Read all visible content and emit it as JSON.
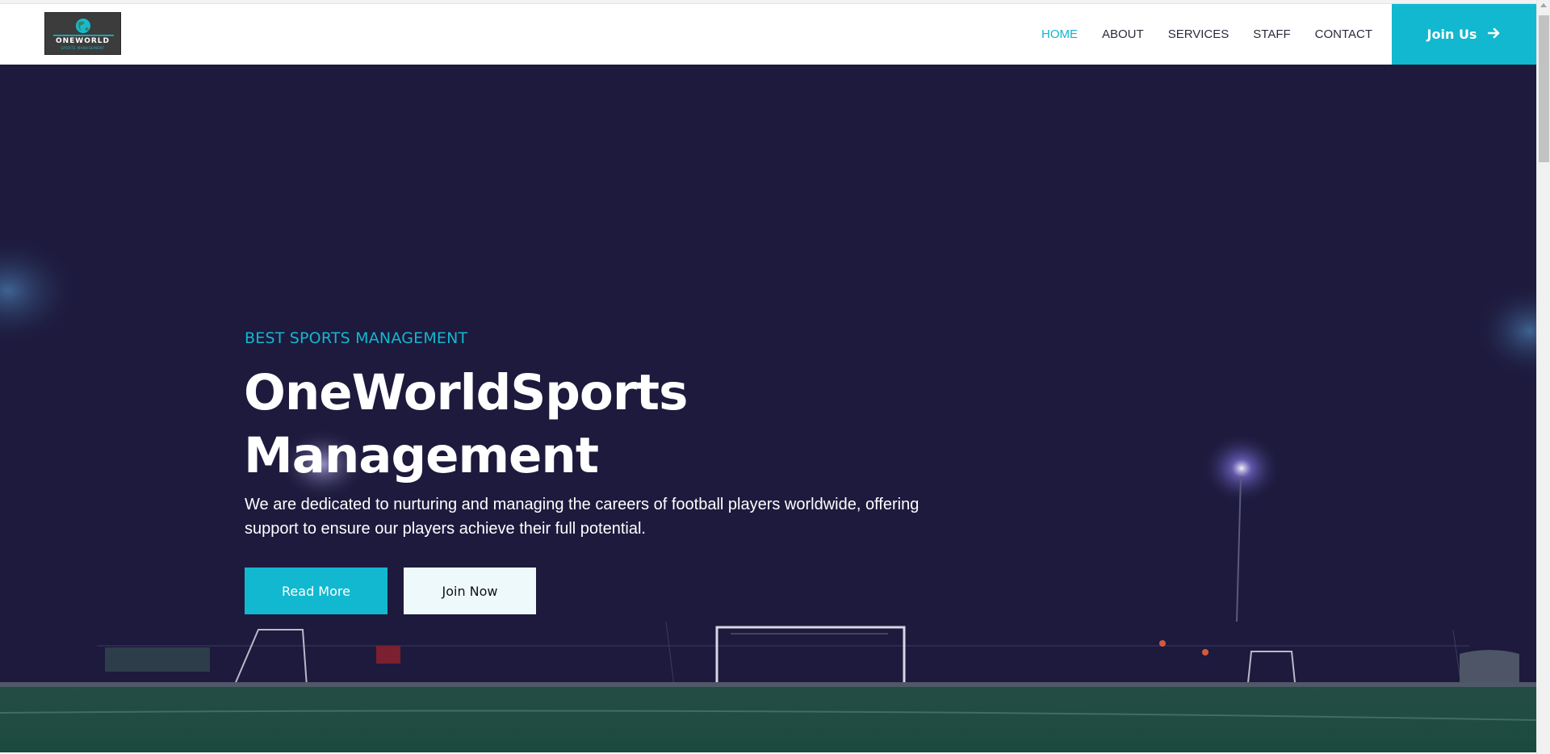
{
  "brand": {
    "logo_text": "ONEWORLD",
    "logo_subtext": "SPORTS MANAGEMENT"
  },
  "nav": {
    "items": [
      {
        "label": "HOME",
        "active": true
      },
      {
        "label": "ABOUT",
        "active": false
      },
      {
        "label": "SERVICES",
        "active": false
      },
      {
        "label": "STAFF",
        "active": false
      },
      {
        "label": "CONTACT",
        "active": false
      }
    ],
    "cta_label": "Join Us",
    "cta_icon": "arrow-right-icon"
  },
  "hero": {
    "eyebrow": "BEST SPORTS MANAGEMENT",
    "title_line1": "OneWorldSports",
    "title_line2": "Management",
    "description": "We are dedicated to nurturing and managing the careers of football players worldwide, offering support to ensure our players achieve their full potential.",
    "primary_button": "Read More",
    "secondary_button": "Join Now"
  },
  "colors": {
    "accent": "#12b8cf",
    "hero_overlay": "#1d1a3d",
    "nav_text": "#2b2b3d",
    "pitch": "#1f4a40"
  }
}
